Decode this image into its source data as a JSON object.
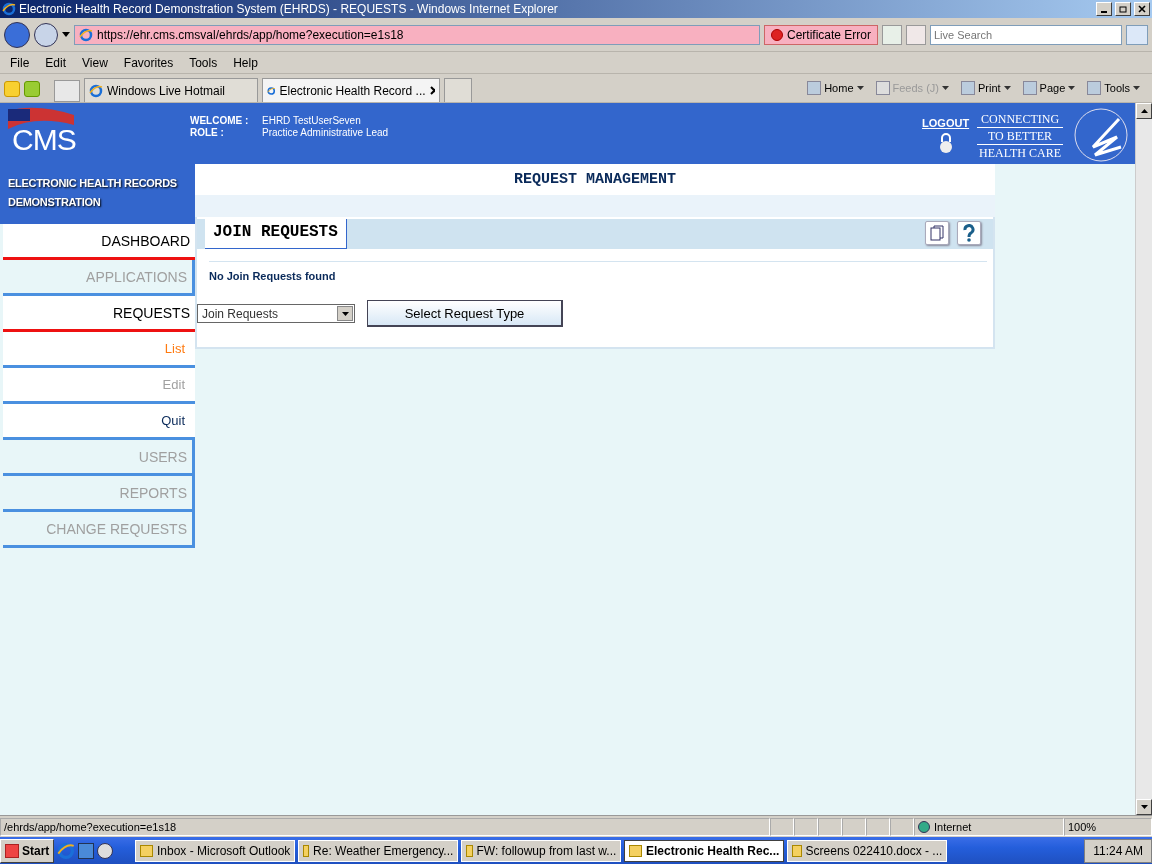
{
  "window": {
    "title": "Electronic Health Record Demonstration System (EHRDS) - REQUESTS - Windows Internet Explorer"
  },
  "address_bar": {
    "url": "https://ehr.cms.cmsval/ehrds/app/home?execution=e1s18",
    "certificate_error": "Certificate Error",
    "search_placeholder": "Live Search"
  },
  "menu_bar": [
    "File",
    "Edit",
    "View",
    "Favorites",
    "Tools",
    "Help"
  ],
  "browser_tabs": [
    {
      "label": "Windows Live Hotmail",
      "selected": false
    },
    {
      "label": "Electronic Health Record ...",
      "selected": true
    }
  ],
  "command_bar": [
    {
      "label": "Home",
      "disabled": false
    },
    {
      "label": "Feeds (J)",
      "disabled": true
    },
    {
      "label": "Print",
      "disabled": false
    },
    {
      "label": "Page",
      "disabled": false
    },
    {
      "label": "Tools",
      "disabled": false
    }
  ],
  "header": {
    "logo": "CMS",
    "welcome_label": "WELCOME :",
    "welcome_value": "EHRD TestUserSeven",
    "role_label": "ROLE :",
    "role_value": "Practice Administrative Lead",
    "logout": "LOGOUT",
    "tagline": [
      "CONNECTING",
      "TO BETTER",
      "HEALTH CARE"
    ]
  },
  "sidebar": {
    "title": "ELECTRONIC HEALTH RECORDS DEMONSTRATION",
    "items": [
      {
        "kind": "section",
        "label": "DASHBOARD",
        "disabled": false
      },
      {
        "kind": "section",
        "label": "APPLICATIONS",
        "disabled": true
      },
      {
        "kind": "section",
        "label": "REQUESTS",
        "disabled": false
      },
      {
        "kind": "sub",
        "label": "List",
        "selected": true,
        "disabled": false
      },
      {
        "kind": "sub",
        "label": "Edit",
        "selected": false,
        "disabled": true
      },
      {
        "kind": "sub",
        "label": "Quit",
        "selected": false,
        "disabled": false
      },
      {
        "kind": "section",
        "label": "USERS",
        "disabled": true
      },
      {
        "kind": "section",
        "label": "REPORTS",
        "disabled": true
      },
      {
        "kind": "section",
        "label": "CHANGE REQUESTS",
        "disabled": true
      }
    ]
  },
  "main": {
    "title": "REQUEST MANAGEMENT",
    "panel_tab": "JOIN REQUESTS",
    "message": "No Join Requests found",
    "request_type": "Join Requests",
    "button": "Select Request Type"
  },
  "status_bar": {
    "url": "/ehrds/app/home?execution=e1s18",
    "zone": "Internet",
    "zoom": "100%"
  },
  "taskbar": {
    "start": "Start",
    "items": [
      {
        "label": "Inbox - Microsoft Outlook",
        "selected": false
      },
      {
        "label": "Re: Weather Emergency...",
        "selected": false
      },
      {
        "label": "FW: followup from last w...",
        "selected": false
      },
      {
        "label": "Electronic Health Rec...",
        "selected": true
      },
      {
        "label": "Screens 022410.docx - ...",
        "selected": false
      }
    ],
    "clock": "11:24 AM"
  }
}
